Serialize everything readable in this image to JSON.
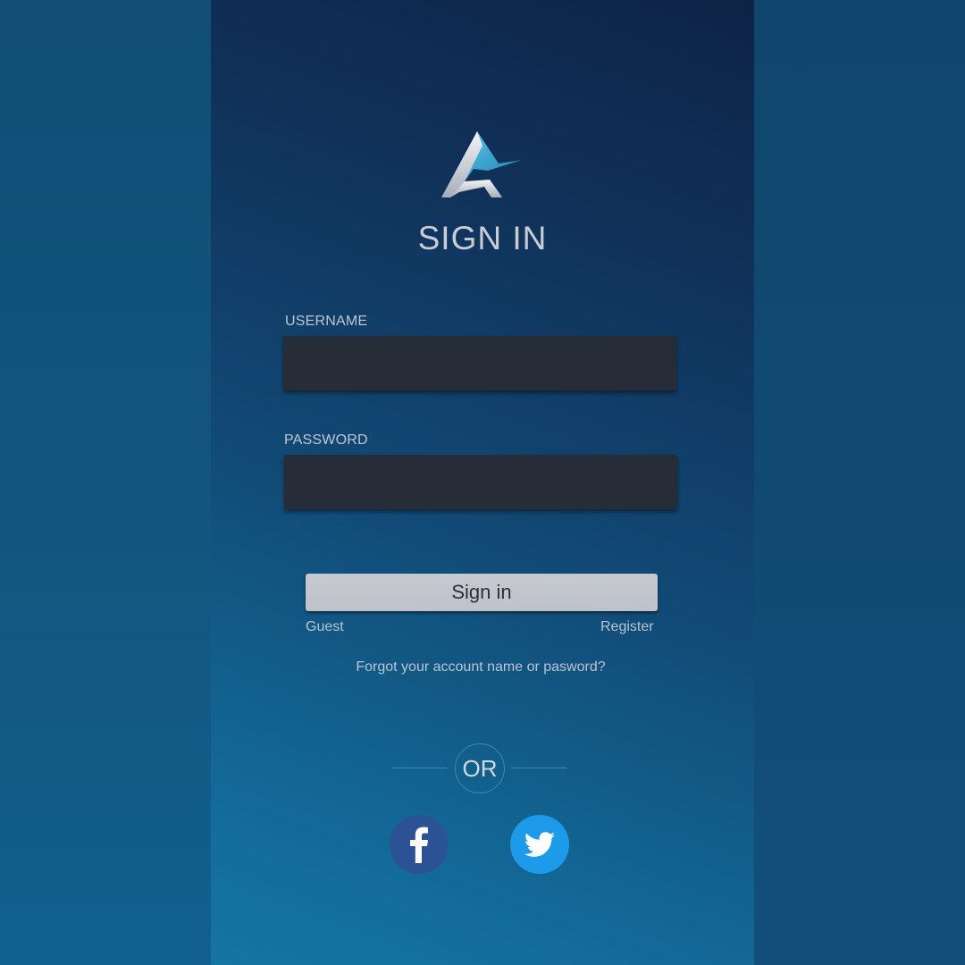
{
  "page": {
    "title": "SIGN IN",
    "accent_color": "#1d9bea",
    "panel_color": "#10325a"
  },
  "logo": {
    "icon": "brand-logo-icon"
  },
  "form": {
    "username_label": "USERNAME",
    "username_value": "",
    "password_label": "PASSWORD",
    "password_value": "",
    "submit_label": "Sign in"
  },
  "links": {
    "guest": "Guest",
    "register": "Register",
    "forgot": "Forgot your account name or pasword?"
  },
  "divider": {
    "text": "OR"
  },
  "social": {
    "facebook_icon": "facebook-icon",
    "facebook_color": "#2b5295",
    "twitter_icon": "twitter-icon",
    "twitter_color": "#1d9bea"
  }
}
